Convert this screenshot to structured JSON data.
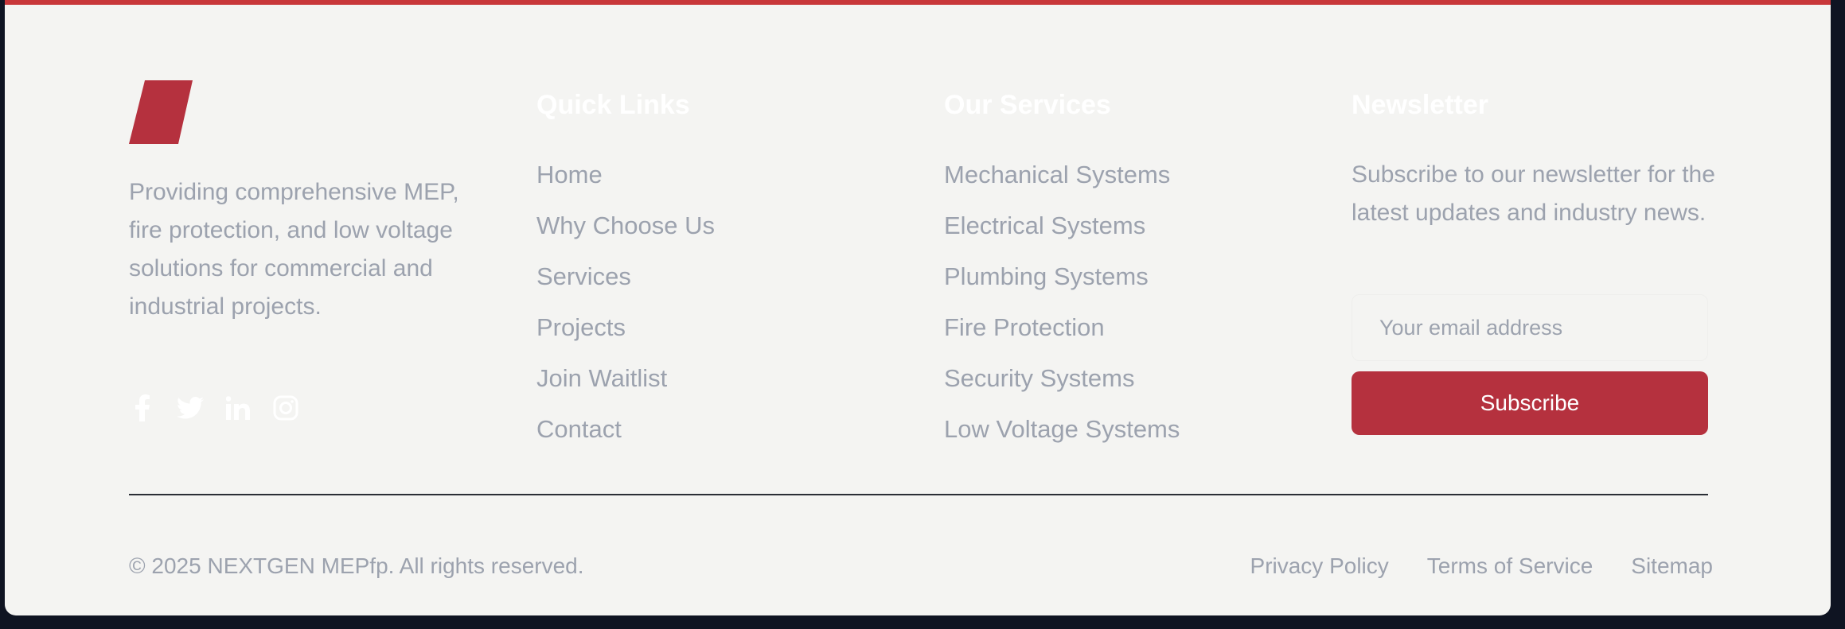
{
  "brand": {
    "logo_icon": "parallelogram-logo",
    "accent_color": "#c8373a",
    "description": "Providing comprehensive MEP, fire protection, and low voltage solutions for commercial and industrial projects.",
    "socials": [
      {
        "icon": "facebook-icon"
      },
      {
        "icon": "twitter-icon"
      },
      {
        "icon": "linkedin-icon"
      },
      {
        "icon": "instagram-icon"
      }
    ]
  },
  "quick_links": {
    "heading": "Quick Links",
    "items": [
      "Home",
      "Why Choose Us",
      "Services",
      "Projects",
      "Join Waitlist",
      "Contact"
    ]
  },
  "services": {
    "heading": "Our Services",
    "items": [
      "Mechanical Systems",
      "Electrical Systems",
      "Plumbing Systems",
      "Fire Protection",
      "Security Systems",
      "Low Voltage Systems"
    ]
  },
  "newsletter": {
    "heading": "Newsletter",
    "description": "Subscribe to our newsletter for the latest updates and industry news.",
    "email_placeholder": "Your email address",
    "subscribe_label": "Subscribe",
    "button_color": "#b5313e"
  },
  "bottom": {
    "copyright": "© 2025 NEXTGEN MEPfp. All rights reserved.",
    "legal_links": [
      "Privacy Policy",
      "Terms of Service",
      "Sitemap"
    ]
  }
}
